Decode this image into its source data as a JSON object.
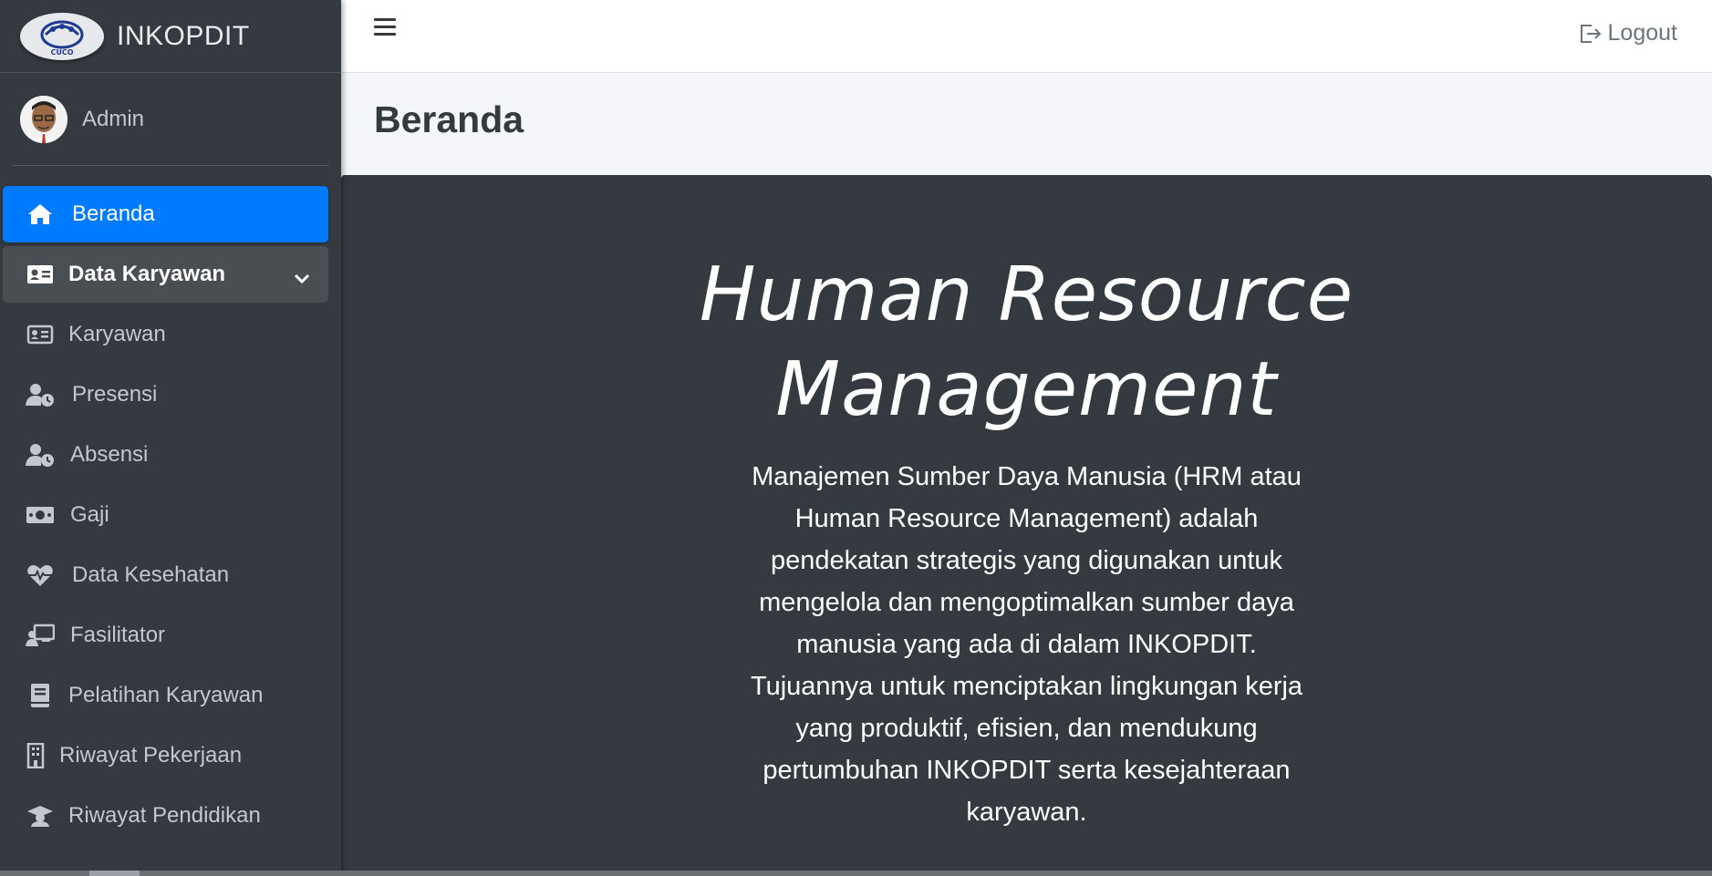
{
  "brand": {
    "name": "INKOPDIT",
    "logo_text": "CUCO"
  },
  "user": {
    "name": "Admin"
  },
  "topbar": {
    "logout_label": "Logout"
  },
  "page": {
    "title": "Beranda"
  },
  "sidebar": {
    "items": [
      {
        "label": "Beranda",
        "icon": "home-icon",
        "state": "active"
      },
      {
        "label": "Data Karyawan",
        "icon": "id-card-icon",
        "state": "open"
      },
      {
        "label": "Karyawan",
        "icon": "id-card-icon"
      },
      {
        "label": "Presensi",
        "icon": "user-clock-icon"
      },
      {
        "label": "Absensi",
        "icon": "user-clock-icon"
      },
      {
        "label": "Gaji",
        "icon": "money-icon"
      },
      {
        "label": "Data Kesehatan",
        "icon": "heartbeat-icon"
      },
      {
        "label": "Fasilitator",
        "icon": "chalkboard-teacher-icon"
      },
      {
        "label": "Pelatihan Karyawan",
        "icon": "book-icon"
      },
      {
        "label": "Riwayat Pekerjaan",
        "icon": "building-icon"
      },
      {
        "label": "Riwayat Pendidikan",
        "icon": "graduation-cap-icon"
      }
    ]
  },
  "hero": {
    "title": "Human Resource Management",
    "description": "Manajemen Sumber Daya Manusia (HRM atau Human Resource Management) adalah pendekatan strategis yang digunakan untuk mengelola dan mengoptimalkan sumber daya manusia yang ada di dalam INKOPDIT. Tujuannya untuk menciptakan lingkungan kerja yang produktif, efisien, dan mendukung pertumbuhan INKOPDIT serta kesejahteraan karyawan."
  },
  "colors": {
    "sidebar_bg": "#343a40",
    "active": "#007bff",
    "hero_bg": "#343a40"
  }
}
